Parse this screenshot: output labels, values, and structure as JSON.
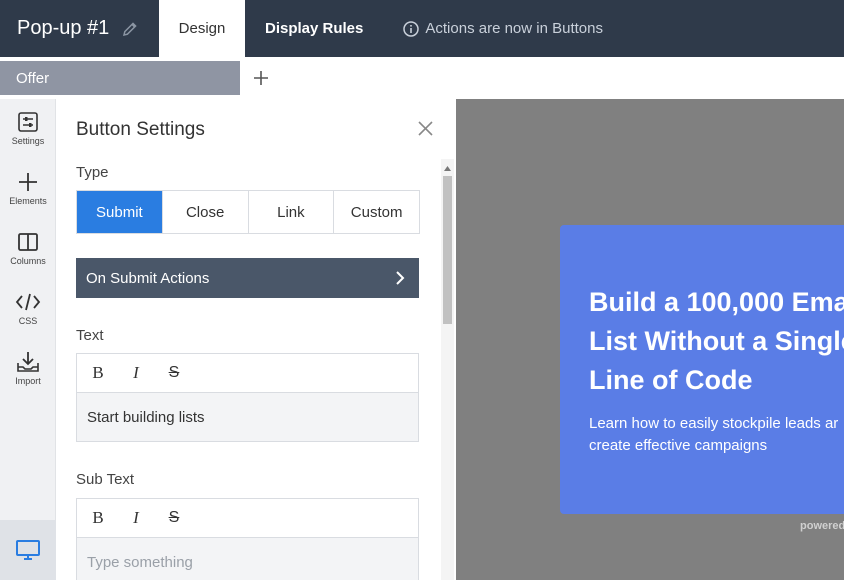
{
  "header": {
    "title": "Pop-up #1",
    "tabs": [
      {
        "label": "Design",
        "active": true
      },
      {
        "label": "Display Rules",
        "active": false
      }
    ],
    "notice": "Actions are now in Buttons"
  },
  "offer_tab": {
    "label": "Offer"
  },
  "rail": {
    "items": [
      {
        "label": "Settings",
        "icon": "settings-sliders-icon"
      },
      {
        "label": "Elements",
        "icon": "plus-icon"
      },
      {
        "label": "Columns",
        "icon": "columns-icon"
      },
      {
        "label": "CSS",
        "icon": "code-icon"
      },
      {
        "label": "Import",
        "icon": "import-icon"
      }
    ],
    "bottom_icon": "desktop-icon"
  },
  "panel": {
    "title": "Button Settings",
    "type_label": "Type",
    "type_options": [
      "Submit",
      "Close",
      "Link",
      "Custom"
    ],
    "type_selected": "Submit",
    "submit_actions_label": "On Submit Actions",
    "text_label": "Text",
    "text_value": "Start building lists",
    "subtext_label": "Sub Text",
    "subtext_placeholder": "Type something",
    "toolbar": {
      "bold": "B",
      "italic": "I",
      "strike": "S"
    }
  },
  "preview": {
    "headline": "Build a 100,000 Ema\nList Without a Single\nLine of Code",
    "subline": "Learn how to easily stockpile leads ar\ncreate effective campaigns",
    "powered": "powered"
  },
  "colors": {
    "topbar": "#2f3a4a",
    "active_blue": "#2a7de1",
    "popup_blue": "#5a7de6",
    "actions_bar": "#4a5769"
  }
}
